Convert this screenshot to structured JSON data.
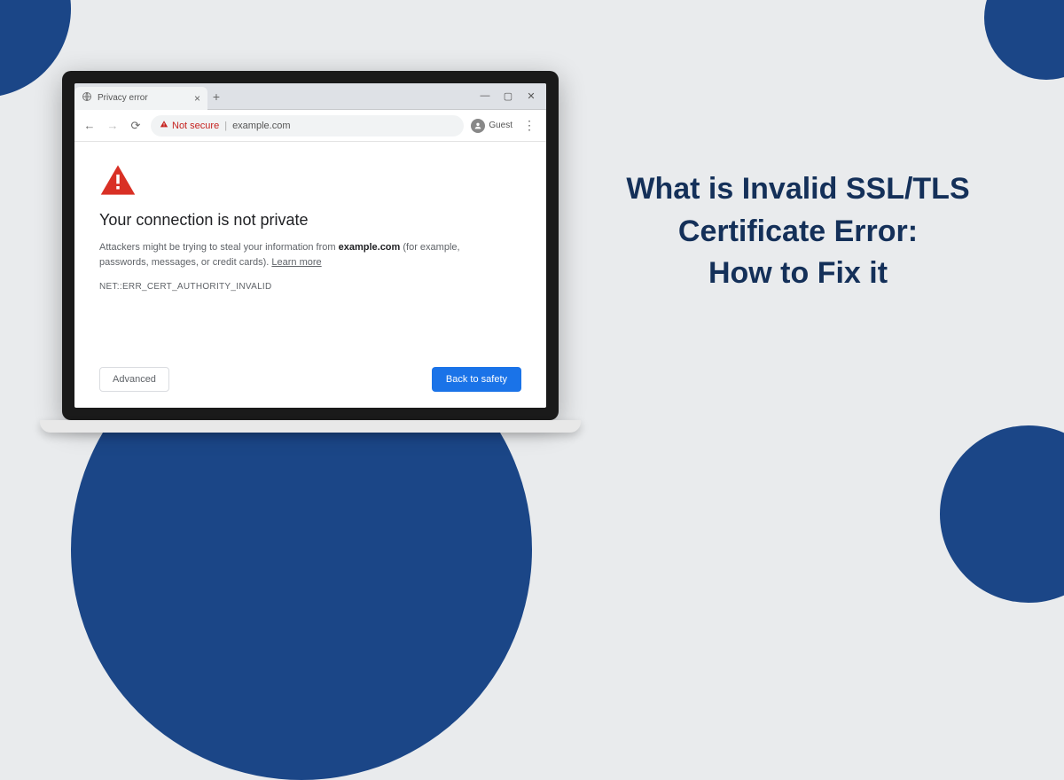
{
  "headline": {
    "line1": "What is Invalid SSL/TLS",
    "line2": "Certificate Error:",
    "line3": "How to Fix it"
  },
  "browser": {
    "tab_title": "Privacy error",
    "security_label": "Not secure",
    "url": "example.com",
    "guest_label": "Guest",
    "new_tab_glyph": "+",
    "close_glyph": "×",
    "win": {
      "min": "—",
      "max": "▢",
      "close": "✕"
    },
    "nav": {
      "back": "←",
      "forward": "→",
      "reload": "⟳"
    },
    "kebab": "⋮"
  },
  "error": {
    "heading": "Your connection is not private",
    "body_pre": "Attackers might be trying to steal your information from ",
    "body_domain": "example.com",
    "body_post": " (for example, passwords, messages, or credit cards). ",
    "learn_more": "Learn more",
    "code": "NET::ERR_CERT_AUTHORITY_INVALID",
    "advanced_label": "Advanced",
    "back_label": "Back to safety"
  },
  "colors": {
    "accent": "#1b4687",
    "danger": "#c5221f",
    "primary_button": "#1a73e8"
  }
}
